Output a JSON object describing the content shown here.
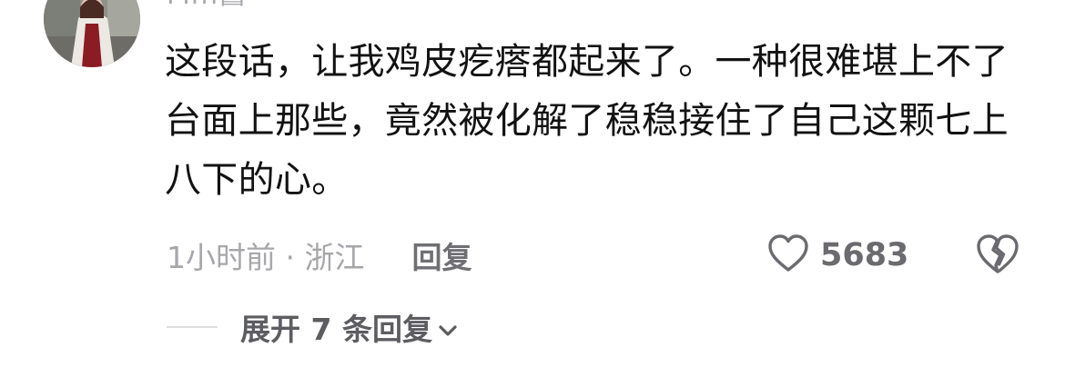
{
  "comment": {
    "username": "Mm酱",
    "text": "这段话，让我鸡皮疙瘩都起来了。一种很难堪上不了台面上那些，竟然被化解了稳稳接住了自己这颗七上八下的心。",
    "time_location": "1小时前 · 浙江",
    "reply_label": "回复",
    "like_count": "5683",
    "expand_replies_label": "展开 7 条回复"
  },
  "icons": {
    "like": "heart-outline-icon",
    "dislike": "broken-heart-icon",
    "expand": "chevron-down-icon"
  },
  "colors": {
    "text": "#121212",
    "meta": "#a7a7ab",
    "action": "#6f6f74"
  }
}
